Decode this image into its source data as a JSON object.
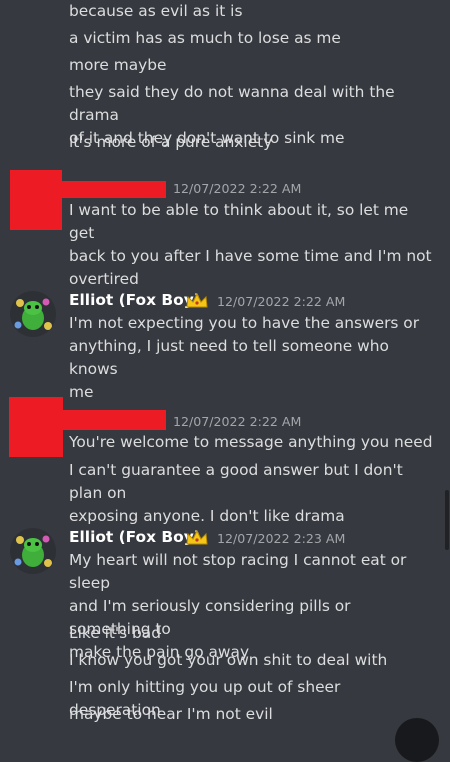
{
  "messages_top": [
    "because as evil as it is",
    "a victim has as much to lose as me",
    "more maybe",
    "they said they do not wanna deal with the drama\nof it and they don't want to sink me",
    "it's more of a pure anxiety"
  ],
  "group1": {
    "timestamp": "12/07/2022 2:22 AM",
    "lines": [
      "I want to be able to think about it, so let me get\nback to you after I have some time and I'm not\novertired"
    ]
  },
  "group2": {
    "author": "Elliot (Fox Boy)",
    "badge_icon": "crown-emoji",
    "timestamp": "12/07/2022 2:22 AM",
    "lines": [
      "I'm not expecting you to have the answers or\nanything, I just need to tell someone who knows\nme"
    ]
  },
  "group3": {
    "timestamp": "12/07/2022 2:22 AM",
    "lines": [
      "You're welcome to message anything you need",
      "I can't guarantee a good answer but I don't plan on\nexposing anyone. I don't like drama"
    ]
  },
  "group4": {
    "author": "Elliot (Fox Boy)",
    "badge_icon": "crown-emoji",
    "timestamp": "12/07/2022 2:23 AM",
    "lines": [
      "My heart will not stop racing I cannot eat or sleep\nand I'm seriously considering pills or something to\nmake the pain go away",
      "Like it's bad",
      "I know you got your own shit to deal with",
      "I'm only hitting you up out of sheer desperation",
      "maybe to hear I'm not evil"
    ]
  },
  "colors": {
    "background": "#36393f",
    "text": "#dcddde",
    "timestamp": "#a3a6aa",
    "redaction": "#ed1c24"
  }
}
